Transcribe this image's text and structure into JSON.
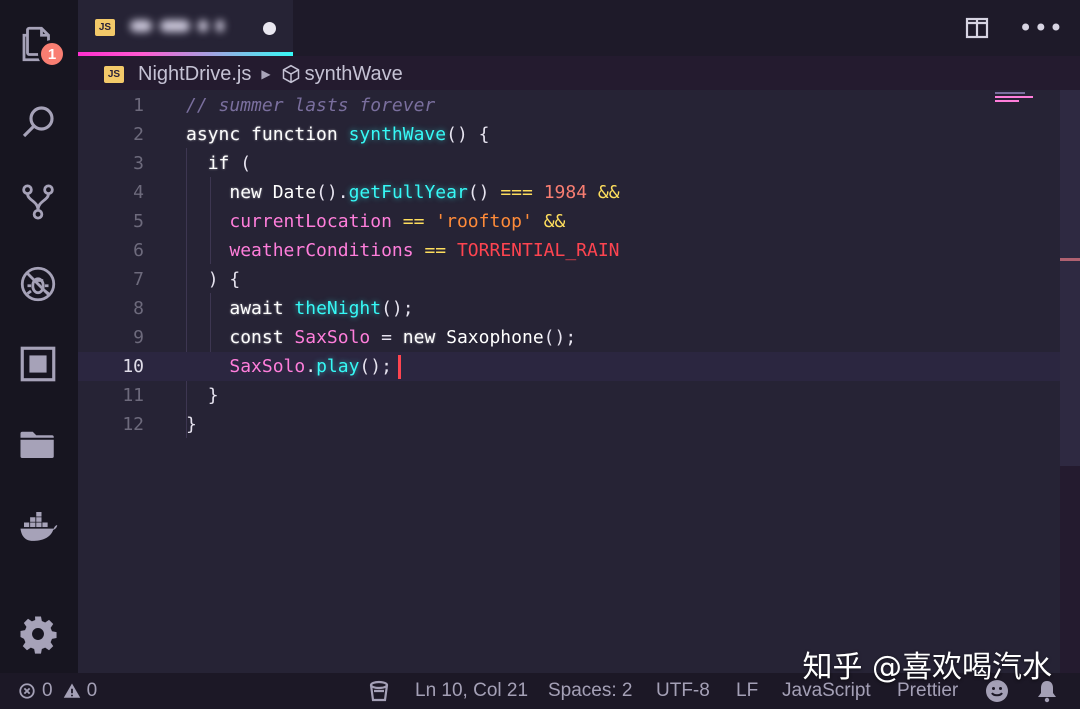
{
  "activity_bar": {
    "explorer_badge": "1",
    "icons": [
      "files-icon",
      "search-icon",
      "source-control-icon",
      "debug-icon",
      "extensions-icon",
      "folder-icon",
      "docker-icon",
      "gear-icon"
    ]
  },
  "tab": {
    "file_type_badge": "JS"
  },
  "breadcrumb": {
    "file_badge": "JS",
    "file": "NightDrive.js",
    "symbol": "synthWave"
  },
  "editor": {
    "active_line": 10,
    "lines": [
      {
        "n": "1",
        "tokens": [
          {
            "c": "tk-comment",
            "t": "// summer lasts forever"
          }
        ]
      },
      {
        "n": "2",
        "tokens": [
          {
            "c": "tk-kwwhite",
            "t": "async function "
          },
          {
            "c": "tk-fn",
            "t": "synthWave"
          },
          {
            "c": "tk-punc",
            "t": "() {"
          }
        ]
      },
      {
        "n": "3",
        "tokens": [
          {
            "c": "tk-plain",
            "t": "  "
          },
          {
            "c": "tk-kwwhite",
            "t": "if"
          },
          {
            "c": "tk-punc",
            "t": " ("
          }
        ]
      },
      {
        "n": "4",
        "tokens": [
          {
            "c": "tk-plain",
            "t": "    "
          },
          {
            "c": "tk-kwwhite",
            "t": "new "
          },
          {
            "c": "tk-plain",
            "t": "Date"
          },
          {
            "c": "tk-punc",
            "t": "()."
          },
          {
            "c": "tk-fn",
            "t": "getFullYear"
          },
          {
            "c": "tk-punc",
            "t": "() "
          },
          {
            "c": "tk-op",
            "t": "==="
          },
          {
            "c": "tk-plain",
            "t": " "
          },
          {
            "c": "tk-num",
            "t": "1984"
          },
          {
            "c": "tk-plain",
            "t": " "
          },
          {
            "c": "tk-op",
            "t": "&&"
          }
        ]
      },
      {
        "n": "5",
        "tokens": [
          {
            "c": "tk-plain",
            "t": "    "
          },
          {
            "c": "tk-var",
            "t": "currentLocation"
          },
          {
            "c": "tk-plain",
            "t": " "
          },
          {
            "c": "tk-op",
            "t": "=="
          },
          {
            "c": "tk-plain",
            "t": " "
          },
          {
            "c": "tk-str",
            "t": "'rooftop'"
          },
          {
            "c": "tk-plain",
            "t": " "
          },
          {
            "c": "tk-op",
            "t": "&&"
          }
        ]
      },
      {
        "n": "6",
        "tokens": [
          {
            "c": "tk-plain",
            "t": "    "
          },
          {
            "c": "tk-var",
            "t": "weatherConditions"
          },
          {
            "c": "tk-plain",
            "t": " "
          },
          {
            "c": "tk-op",
            "t": "=="
          },
          {
            "c": "tk-plain",
            "t": " "
          },
          {
            "c": "tk-const",
            "t": "TORRENTIAL_RAIN"
          }
        ]
      },
      {
        "n": "7",
        "tokens": [
          {
            "c": "tk-plain",
            "t": "  "
          },
          {
            "c": "tk-punc",
            "t": ") {"
          }
        ]
      },
      {
        "n": "8",
        "tokens": [
          {
            "c": "tk-plain",
            "t": "    "
          },
          {
            "c": "tk-kwwhite",
            "t": "await "
          },
          {
            "c": "tk-fn",
            "t": "theNight"
          },
          {
            "c": "tk-punc",
            "t": "();"
          }
        ]
      },
      {
        "n": "9",
        "tokens": [
          {
            "c": "tk-plain",
            "t": "    "
          },
          {
            "c": "tk-kwwhite",
            "t": "const "
          },
          {
            "c": "tk-var",
            "t": "SaxSolo"
          },
          {
            "c": "tk-punc",
            "t": " = "
          },
          {
            "c": "tk-kwwhite",
            "t": "new "
          },
          {
            "c": "tk-plain",
            "t": "Saxophone"
          },
          {
            "c": "tk-punc",
            "t": "();"
          }
        ]
      },
      {
        "n": "10",
        "tokens": [
          {
            "c": "tk-plain",
            "t": "    "
          },
          {
            "c": "tk-var",
            "t": "SaxSolo"
          },
          {
            "c": "tk-punc",
            "t": "."
          },
          {
            "c": "tk-fn",
            "t": "play"
          },
          {
            "c": "tk-punc",
            "t": "();"
          }
        ]
      },
      {
        "n": "11",
        "tokens": [
          {
            "c": "tk-plain",
            "t": "  "
          },
          {
            "c": "tk-punc",
            "t": "}"
          }
        ]
      },
      {
        "n": "12",
        "tokens": [
          {
            "c": "tk-punc",
            "t": "}"
          }
        ]
      }
    ]
  },
  "status_bar": {
    "errors": "0",
    "warnings": "0",
    "position": "Ln 10, Col 21",
    "spaces": "Spaces: 2",
    "encoding": "UTF-8",
    "eol": "LF",
    "language": "JavaScript",
    "formatter": "Prettier"
  },
  "watermark": "知乎 @喜欢喝汽水",
  "colors": {
    "background": "#262335",
    "activity_bar": "#171520",
    "accent_pink": "#ff7edb",
    "accent_cyan": "#36f9f6",
    "accent_yellow": "#fede5d",
    "badge": "#f97e72"
  }
}
